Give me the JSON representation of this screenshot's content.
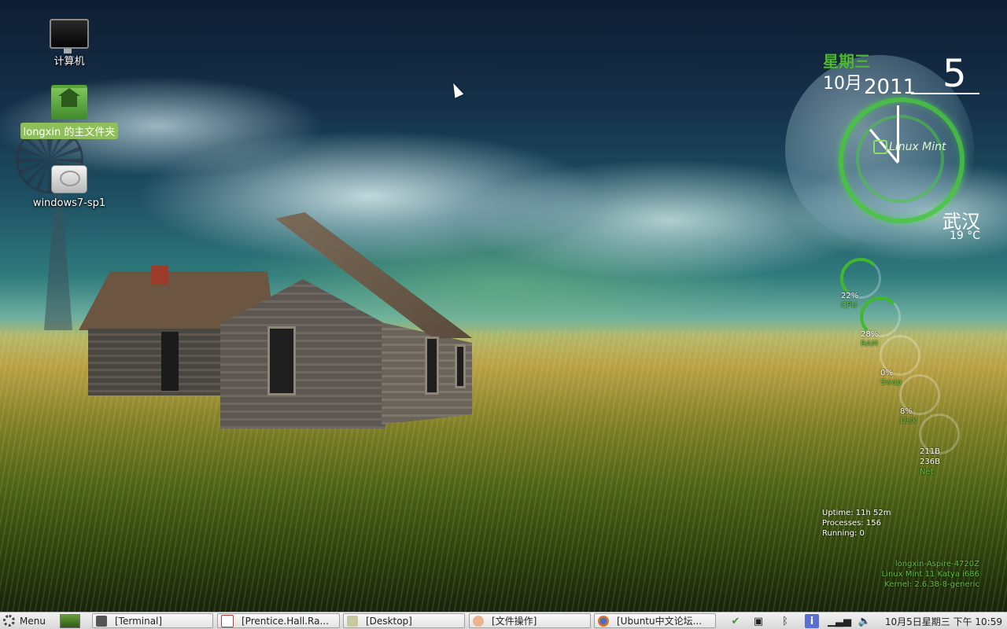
{
  "desktop": {
    "icons": [
      {
        "label": "计算机",
        "icon": "computer-icon"
      },
      {
        "label": "longxin 的主文件夹",
        "icon": "home-folder-icon"
      },
      {
        "label": "windows7-sp1",
        "icon": "drive-icon"
      }
    ]
  },
  "clock_widget": {
    "weekday": "星期三",
    "month": "10月",
    "year": "2011",
    "day": "5",
    "logo": "Linux Mint",
    "city": "武汉",
    "temperature": "19 °C"
  },
  "system_monitor": {
    "gauges": [
      {
        "value": "22%",
        "label": "CPU"
      },
      {
        "value": "28%",
        "label": "RAM"
      },
      {
        "value": "0%",
        "label": "Swap"
      },
      {
        "value": "8%",
        "label": "Disk"
      },
      {
        "value_up": "211B",
        "value_down": "236B",
        "label": "Net"
      }
    ],
    "uptime": "Uptime: 11h 52m",
    "processes": "Processes: 156",
    "running": "Running: 0",
    "hostname": "longxin-Aspire-4720Z",
    "distro": "Linux Mint 11 Katya  i686",
    "kernel": "Kernel: 2.6.38-8-generic"
  },
  "taskbar": {
    "menu_label": "Menu",
    "tasks": [
      {
        "label": "[Terminal]",
        "icon": "terminal-icon",
        "color": "#555555"
      },
      {
        "label": "[Prentice.Hall.Ra...",
        "icon": "pdf-icon",
        "color": "#cc3333"
      },
      {
        "label": "[Desktop]",
        "icon": "folder-icon",
        "color": "#b8b890"
      },
      {
        "label": "[文件操作]",
        "icon": "document-icon",
        "color": "#d08060"
      },
      {
        "label": "[Ubuntu中文论坛...",
        "icon": "firefox-icon",
        "color": "#e07020"
      }
    ],
    "clock": "10月5日星期三 下午 10:59"
  },
  "colors": {
    "accent_green": "#4db82c",
    "taskbar_bg": "#e6e6e6"
  }
}
